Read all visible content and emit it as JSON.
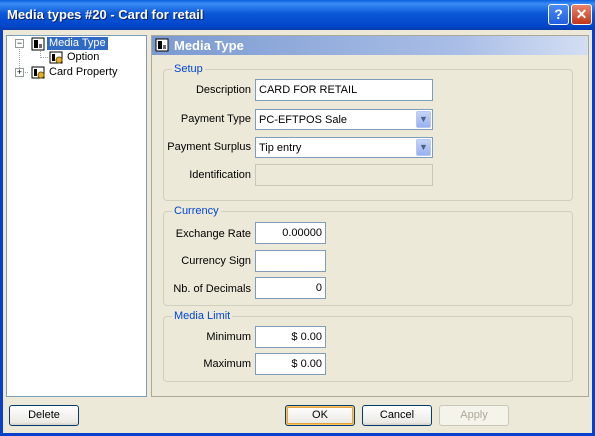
{
  "window": {
    "title": "Media types #20 - Card for retail",
    "help_glyph": "?",
    "close_glyph": "✕"
  },
  "tree": {
    "items": [
      {
        "label": "Media Type",
        "expander": "−",
        "selected": true
      },
      {
        "label": "Option"
      },
      {
        "label": "Card Property",
        "expander": "+"
      }
    ]
  },
  "panel": {
    "title": "Media Type"
  },
  "setup": {
    "title": "Setup",
    "description_label": "Description",
    "description_value": "CARD FOR RETAIL",
    "payment_type_label": "Payment Type",
    "payment_type_value": "PC-EFTPOS Sale",
    "payment_surplus_label": "Payment Surplus",
    "payment_surplus_value": "Tip entry",
    "identification_label": "Identification",
    "identification_value": ""
  },
  "currency": {
    "title": "Currency",
    "exchange_rate_label": "Exchange Rate",
    "exchange_rate_value": "0.00000",
    "currency_sign_label": "Currency Sign",
    "currency_sign_value": "",
    "decimals_label": "Nb. of Decimals",
    "decimals_value": "0"
  },
  "media_limit": {
    "title": "Media Limit",
    "minimum_label": "Minimum",
    "minimum_value": "$ 0.00",
    "maximum_label": "Maximum",
    "maximum_value": "$ 0.00"
  },
  "buttons": {
    "delete": "Delete",
    "ok": "OK",
    "cancel": "Cancel",
    "apply": "Apply"
  },
  "colors": {
    "titlebar": "#0a58d8",
    "selection": "#316ac5",
    "group_title": "#0046d5",
    "panel_header": "#7b9ad1"
  },
  "dropdown_glyph": "▼"
}
